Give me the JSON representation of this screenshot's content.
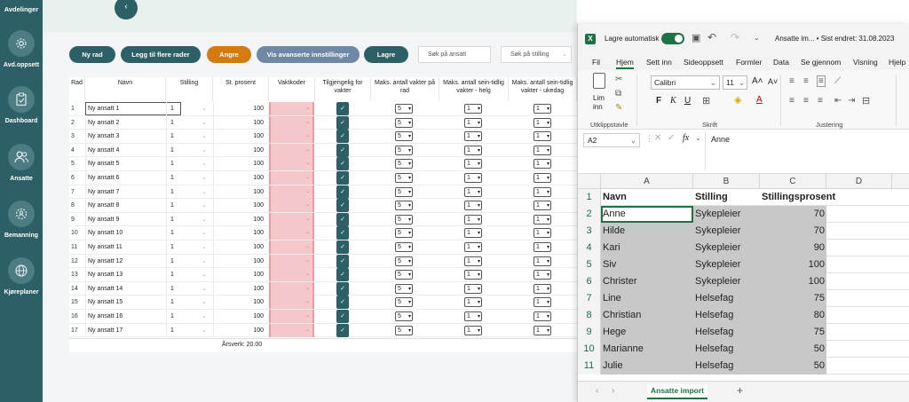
{
  "sidebar": {
    "top_label": "Avdelinger",
    "items": [
      {
        "label": "Avd.oppsett",
        "icon": "gear-icon"
      },
      {
        "label": "Dashboard",
        "icon": "clipboard-icon"
      },
      {
        "label": "Ansatte",
        "icon": "people-icon"
      },
      {
        "label": "Bemanning",
        "icon": "team-cog-icon"
      },
      {
        "label": "Kjøreplaner",
        "icon": "globe-icon"
      }
    ]
  },
  "toolbar": {
    "ny_rad": "Ny rad",
    "legg_til": "Legg til flere rader",
    "angre": "Angre",
    "avanserte": "Vis avanserte innstillinger",
    "lagre": "Lagre",
    "sok_ansatt_placeholder": "Søk på ansatt",
    "sok_stilling_placeholder": "Søk på stilling",
    "colors": {
      "teal": "#2d5f66",
      "orange": "#d47b10",
      "steel": "#6f88a5"
    }
  },
  "grid": {
    "headers": [
      "Rad",
      "Navn",
      "Stilling",
      "St. prosent",
      "Vaktkoder",
      "Tilgjengelig for vakter",
      "Maks. antall vakter på rad",
      "Maks. antall sein-tidlig vakter - helg",
      "Maks. antall sein-tidlig vakter - ukedag"
    ],
    "rows": [
      {
        "rad": "1",
        "navn": "Ny ansatt 1",
        "stilling": "1",
        "pct": "100",
        "maks": "5",
        "helg": "1",
        "ukedag": "1"
      },
      {
        "rad": "2",
        "navn": "Ny ansatt 2",
        "stilling": "1",
        "pct": "100",
        "maks": "5",
        "helg": "1",
        "ukedag": "1"
      },
      {
        "rad": "3",
        "navn": "Ny ansatt 3",
        "stilling": "1",
        "pct": "100",
        "maks": "5",
        "helg": "1",
        "ukedag": "1"
      },
      {
        "rad": "4",
        "navn": "Ny ansatt 4",
        "stilling": "1",
        "pct": "100",
        "maks": "5",
        "helg": "1",
        "ukedag": "1"
      },
      {
        "rad": "5",
        "navn": "Ny ansatt 5",
        "stilling": "1",
        "pct": "100",
        "maks": "5",
        "helg": "1",
        "ukedag": "1"
      },
      {
        "rad": "6",
        "navn": "Ny ansatt 6",
        "stilling": "1",
        "pct": "100",
        "maks": "5",
        "helg": "1",
        "ukedag": "1"
      },
      {
        "rad": "7",
        "navn": "Ny ansatt 7",
        "stilling": "1",
        "pct": "100",
        "maks": "5",
        "helg": "1",
        "ukedag": "1"
      },
      {
        "rad": "8",
        "navn": "Ny ansatt 8",
        "stilling": "1",
        "pct": "100",
        "maks": "5",
        "helg": "1",
        "ukedag": "1"
      },
      {
        "rad": "9",
        "navn": "Ny ansatt 9",
        "stilling": "1",
        "pct": "100",
        "maks": "5",
        "helg": "1",
        "ukedag": "1"
      },
      {
        "rad": "10",
        "navn": "Ny ansatt 10",
        "stilling": "1",
        "pct": "100",
        "maks": "5",
        "helg": "1",
        "ukedag": "1"
      },
      {
        "rad": "11",
        "navn": "Ny ansatt 11",
        "stilling": "1",
        "pct": "100",
        "maks": "5",
        "helg": "1",
        "ukedag": "1"
      },
      {
        "rad": "12",
        "navn": "Ny ansatt 12",
        "stilling": "1",
        "pct": "100",
        "maks": "5",
        "helg": "1",
        "ukedag": "1"
      },
      {
        "rad": "13",
        "navn": "Ny ansatt 13",
        "stilling": "1",
        "pct": "100",
        "maks": "5",
        "helg": "1",
        "ukedag": "1"
      },
      {
        "rad": "14",
        "navn": "Ny ansatt 14",
        "stilling": "1",
        "pct": "100",
        "maks": "5",
        "helg": "1",
        "ukedag": "1"
      },
      {
        "rad": "15",
        "navn": "Ny ansatt 15",
        "stilling": "1",
        "pct": "100",
        "maks": "5",
        "helg": "1",
        "ukedag": "1"
      },
      {
        "rad": "16",
        "navn": "Ny ansatt 16",
        "stilling": "1",
        "pct": "100",
        "maks": "5",
        "helg": "1",
        "ukedag": "1"
      },
      {
        "rad": "17",
        "navn": "Ny ansatt 17",
        "stilling": "1",
        "pct": "100",
        "maks": "5",
        "helg": "1",
        "ukedag": "1"
      }
    ],
    "arsverk": "Årsverk: 20.00"
  },
  "excel": {
    "autosave_label": "Lagre automatisk",
    "title": "Ansatte im... • Sist endret: 31.08.2023",
    "menu": [
      "Fil",
      "Hjem",
      "Sett inn",
      "Sideoppsett",
      "Formler",
      "Data",
      "Se gjennom",
      "Visning",
      "Hjelp"
    ],
    "active_menu": "Hjem",
    "ribbon": {
      "paste": "Lim",
      "paste2": "inn",
      "font": "Calibri",
      "size": "11",
      "group_clipboard": "Utklippstavle",
      "group_font": "Skrift",
      "group_alignment": "Justering"
    },
    "cell_ref": "A2",
    "formula_value": "Anne",
    "columns": [
      "A",
      "B",
      "C",
      "D"
    ],
    "header_row": {
      "a": "Navn",
      "b": "Stilling",
      "c": "Stillingsprosent"
    },
    "rows": [
      {
        "n": "2",
        "a": "Anne",
        "b": "Sykepleier",
        "c": "70"
      },
      {
        "n": "3",
        "a": "Hilde",
        "b": "Sykepleier",
        "c": "70"
      },
      {
        "n": "4",
        "a": "Kari",
        "b": "Sykepleier",
        "c": "90"
      },
      {
        "n": "5",
        "a": "Siv",
        "b": "Sykepleier",
        "c": "100"
      },
      {
        "n": "6",
        "a": "Christer",
        "b": "Sykepleier",
        "c": "100"
      },
      {
        "n": "7",
        "a": "Line",
        "b": "Helsefag",
        "c": "75"
      },
      {
        "n": "8",
        "a": "Christian",
        "b": "Helsefag",
        "c": "80"
      },
      {
        "n": "9",
        "a": "Hege",
        "b": "Helsefag",
        "c": "75"
      },
      {
        "n": "10",
        "a": "Marianne",
        "b": "Helsefag",
        "c": "50"
      },
      {
        "n": "11",
        "a": "Julie",
        "b": "Helsefag",
        "c": "50"
      }
    ],
    "sheet_tab": "Ansatte import"
  }
}
